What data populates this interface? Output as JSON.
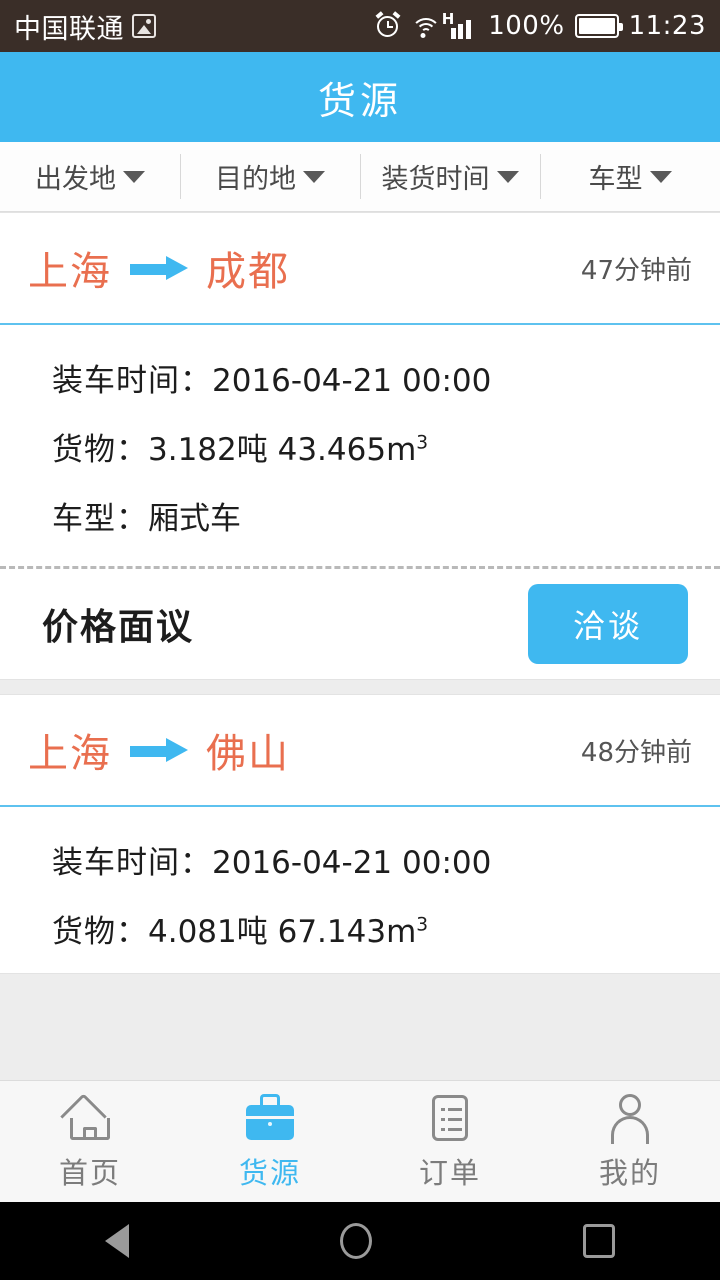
{
  "status_bar": {
    "carrier": "中国联通",
    "photo_icon": "photo-icon",
    "alarm_icon": "alarm-icon",
    "wifi_icon": "wifi-icon",
    "network_type": "H",
    "signal_icon": "signal-bars-icon",
    "battery_percent": "100%",
    "battery_icon": "battery-icon",
    "time": "11:23"
  },
  "app_bar": {
    "title": "货源"
  },
  "filters": [
    {
      "label": "出发地",
      "icon": "chevron-down-icon"
    },
    {
      "label": "目的地",
      "icon": "chevron-down-icon"
    },
    {
      "label": "装货时间",
      "icon": "chevron-down-icon"
    },
    {
      "label": "车型",
      "icon": "chevron-down-icon"
    }
  ],
  "cards": [
    {
      "origin": "上海",
      "arrow_icon": "arrow-right-icon",
      "destination": "成都",
      "posted_ago": "47分钟前",
      "load_time_label": "装车时间：",
      "load_time_value": "2016-04-21 00:00",
      "cargo_label": "货物：",
      "cargo_value": "3.182吨 43.465m",
      "cargo_unit_sup": "3",
      "vehicle_label": "车型：",
      "vehicle_value": "厢式车",
      "price": "价格面议",
      "action_label": "洽谈"
    },
    {
      "origin": "上海",
      "arrow_icon": "arrow-right-icon",
      "destination": "佛山",
      "posted_ago": "48分钟前",
      "load_time_label": "装车时间：",
      "load_time_value": "2016-04-21 00:00",
      "cargo_label": "货物：",
      "cargo_value": "4.081吨 67.143m",
      "cargo_unit_sup": "3"
    }
  ],
  "tabbar": [
    {
      "label": "首页",
      "icon": "home-icon",
      "active": false
    },
    {
      "label": "货源",
      "icon": "briefcase-icon",
      "active": true
    },
    {
      "label": "订单",
      "icon": "list-icon",
      "active": false
    },
    {
      "label": "我的",
      "icon": "person-icon",
      "active": false
    }
  ],
  "android_nav": {
    "back_icon": "back-triangle-icon",
    "home_icon": "home-circle-icon",
    "recents_icon": "recents-square-icon"
  },
  "colors": {
    "accent_blue": "#3fb8f0",
    "route_orange": "#e96f4f",
    "status_bar_bg": "#3a2e28",
    "page_bg": "#ededed"
  }
}
